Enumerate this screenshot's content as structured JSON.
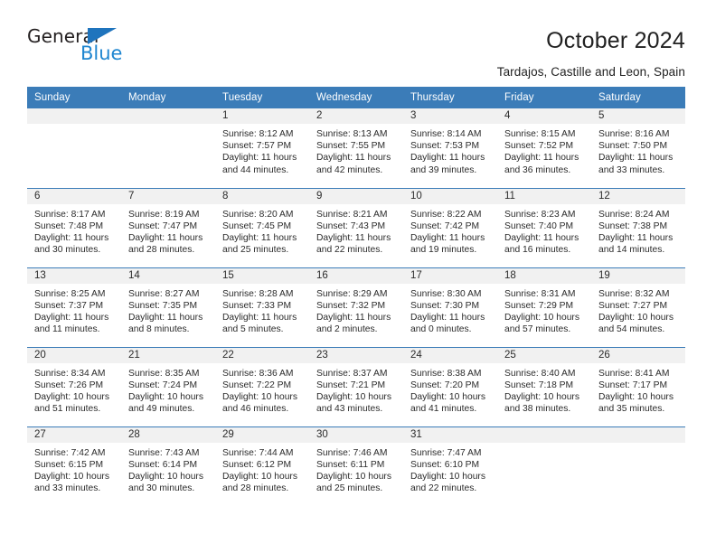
{
  "brand": {
    "name_top": "General",
    "name_bottom": "Blue",
    "triangle_color": "#1f74bd",
    "blue_text_color": "#1f86d0"
  },
  "header": {
    "title": "October 2024",
    "subtitle": "Tardajos, Castille and Leon, Spain"
  },
  "theme": {
    "header_blue": "#3b7cb8",
    "daynum_band": "#f1f1f1",
    "text": "#2b2b2b"
  },
  "weekday_headers": [
    "Sunday",
    "Monday",
    "Tuesday",
    "Wednesday",
    "Thursday",
    "Friday",
    "Saturday"
  ],
  "labels": {
    "sunrise_prefix": "Sunrise:",
    "sunset_prefix": "Sunset:",
    "daylight_prefix": "Daylight:"
  },
  "weeks": [
    [
      {
        "day": ""
      },
      {
        "day": ""
      },
      {
        "day": "1",
        "sunrise": "Sunrise: 8:12 AM",
        "sunset": "Sunset: 7:57 PM",
        "daylight_line1": "Daylight: 11 hours",
        "daylight_line2": "and 44 minutes."
      },
      {
        "day": "2",
        "sunrise": "Sunrise: 8:13 AM",
        "sunset": "Sunset: 7:55 PM",
        "daylight_line1": "Daylight: 11 hours",
        "daylight_line2": "and 42 minutes."
      },
      {
        "day": "3",
        "sunrise": "Sunrise: 8:14 AM",
        "sunset": "Sunset: 7:53 PM",
        "daylight_line1": "Daylight: 11 hours",
        "daylight_line2": "and 39 minutes."
      },
      {
        "day": "4",
        "sunrise": "Sunrise: 8:15 AM",
        "sunset": "Sunset: 7:52 PM",
        "daylight_line1": "Daylight: 11 hours",
        "daylight_line2": "and 36 minutes."
      },
      {
        "day": "5",
        "sunrise": "Sunrise: 8:16 AM",
        "sunset": "Sunset: 7:50 PM",
        "daylight_line1": "Daylight: 11 hours",
        "daylight_line2": "and 33 minutes."
      }
    ],
    [
      {
        "day": "6",
        "sunrise": "Sunrise: 8:17 AM",
        "sunset": "Sunset: 7:48 PM",
        "daylight_line1": "Daylight: 11 hours",
        "daylight_line2": "and 30 minutes."
      },
      {
        "day": "7",
        "sunrise": "Sunrise: 8:19 AM",
        "sunset": "Sunset: 7:47 PM",
        "daylight_line1": "Daylight: 11 hours",
        "daylight_line2": "and 28 minutes."
      },
      {
        "day": "8",
        "sunrise": "Sunrise: 8:20 AM",
        "sunset": "Sunset: 7:45 PM",
        "daylight_line1": "Daylight: 11 hours",
        "daylight_line2": "and 25 minutes."
      },
      {
        "day": "9",
        "sunrise": "Sunrise: 8:21 AM",
        "sunset": "Sunset: 7:43 PM",
        "daylight_line1": "Daylight: 11 hours",
        "daylight_line2": "and 22 minutes."
      },
      {
        "day": "10",
        "sunrise": "Sunrise: 8:22 AM",
        "sunset": "Sunset: 7:42 PM",
        "daylight_line1": "Daylight: 11 hours",
        "daylight_line2": "and 19 minutes."
      },
      {
        "day": "11",
        "sunrise": "Sunrise: 8:23 AM",
        "sunset": "Sunset: 7:40 PM",
        "daylight_line1": "Daylight: 11 hours",
        "daylight_line2": "and 16 minutes."
      },
      {
        "day": "12",
        "sunrise": "Sunrise: 8:24 AM",
        "sunset": "Sunset: 7:38 PM",
        "daylight_line1": "Daylight: 11 hours",
        "daylight_line2": "and 14 minutes."
      }
    ],
    [
      {
        "day": "13",
        "sunrise": "Sunrise: 8:25 AM",
        "sunset": "Sunset: 7:37 PM",
        "daylight_line1": "Daylight: 11 hours",
        "daylight_line2": "and 11 minutes."
      },
      {
        "day": "14",
        "sunrise": "Sunrise: 8:27 AM",
        "sunset": "Sunset: 7:35 PM",
        "daylight_line1": "Daylight: 11 hours",
        "daylight_line2": "and 8 minutes."
      },
      {
        "day": "15",
        "sunrise": "Sunrise: 8:28 AM",
        "sunset": "Sunset: 7:33 PM",
        "daylight_line1": "Daylight: 11 hours",
        "daylight_line2": "and 5 minutes."
      },
      {
        "day": "16",
        "sunrise": "Sunrise: 8:29 AM",
        "sunset": "Sunset: 7:32 PM",
        "daylight_line1": "Daylight: 11 hours",
        "daylight_line2": "and 2 minutes."
      },
      {
        "day": "17",
        "sunrise": "Sunrise: 8:30 AM",
        "sunset": "Sunset: 7:30 PM",
        "daylight_line1": "Daylight: 11 hours",
        "daylight_line2": "and 0 minutes."
      },
      {
        "day": "18",
        "sunrise": "Sunrise: 8:31 AM",
        "sunset": "Sunset: 7:29 PM",
        "daylight_line1": "Daylight: 10 hours",
        "daylight_line2": "and 57 minutes."
      },
      {
        "day": "19",
        "sunrise": "Sunrise: 8:32 AM",
        "sunset": "Sunset: 7:27 PM",
        "daylight_line1": "Daylight: 10 hours",
        "daylight_line2": "and 54 minutes."
      }
    ],
    [
      {
        "day": "20",
        "sunrise": "Sunrise: 8:34 AM",
        "sunset": "Sunset: 7:26 PM",
        "daylight_line1": "Daylight: 10 hours",
        "daylight_line2": "and 51 minutes."
      },
      {
        "day": "21",
        "sunrise": "Sunrise: 8:35 AM",
        "sunset": "Sunset: 7:24 PM",
        "daylight_line1": "Daylight: 10 hours",
        "daylight_line2": "and 49 minutes."
      },
      {
        "day": "22",
        "sunrise": "Sunrise: 8:36 AM",
        "sunset": "Sunset: 7:22 PM",
        "daylight_line1": "Daylight: 10 hours",
        "daylight_line2": "and 46 minutes."
      },
      {
        "day": "23",
        "sunrise": "Sunrise: 8:37 AM",
        "sunset": "Sunset: 7:21 PM",
        "daylight_line1": "Daylight: 10 hours",
        "daylight_line2": "and 43 minutes."
      },
      {
        "day": "24",
        "sunrise": "Sunrise: 8:38 AM",
        "sunset": "Sunset: 7:20 PM",
        "daylight_line1": "Daylight: 10 hours",
        "daylight_line2": "and 41 minutes."
      },
      {
        "day": "25",
        "sunrise": "Sunrise: 8:40 AM",
        "sunset": "Sunset: 7:18 PM",
        "daylight_line1": "Daylight: 10 hours",
        "daylight_line2": "and 38 minutes."
      },
      {
        "day": "26",
        "sunrise": "Sunrise: 8:41 AM",
        "sunset": "Sunset: 7:17 PM",
        "daylight_line1": "Daylight: 10 hours",
        "daylight_line2": "and 35 minutes."
      }
    ],
    [
      {
        "day": "27",
        "sunrise": "Sunrise: 7:42 AM",
        "sunset": "Sunset: 6:15 PM",
        "daylight_line1": "Daylight: 10 hours",
        "daylight_line2": "and 33 minutes."
      },
      {
        "day": "28",
        "sunrise": "Sunrise: 7:43 AM",
        "sunset": "Sunset: 6:14 PM",
        "daylight_line1": "Daylight: 10 hours",
        "daylight_line2": "and 30 minutes."
      },
      {
        "day": "29",
        "sunrise": "Sunrise: 7:44 AM",
        "sunset": "Sunset: 6:12 PM",
        "daylight_line1": "Daylight: 10 hours",
        "daylight_line2": "and 28 minutes."
      },
      {
        "day": "30",
        "sunrise": "Sunrise: 7:46 AM",
        "sunset": "Sunset: 6:11 PM",
        "daylight_line1": "Daylight: 10 hours",
        "daylight_line2": "and 25 minutes."
      },
      {
        "day": "31",
        "sunrise": "Sunrise: 7:47 AM",
        "sunset": "Sunset: 6:10 PM",
        "daylight_line1": "Daylight: 10 hours",
        "daylight_line2": "and 22 minutes."
      },
      {
        "day": ""
      },
      {
        "day": ""
      }
    ]
  ]
}
